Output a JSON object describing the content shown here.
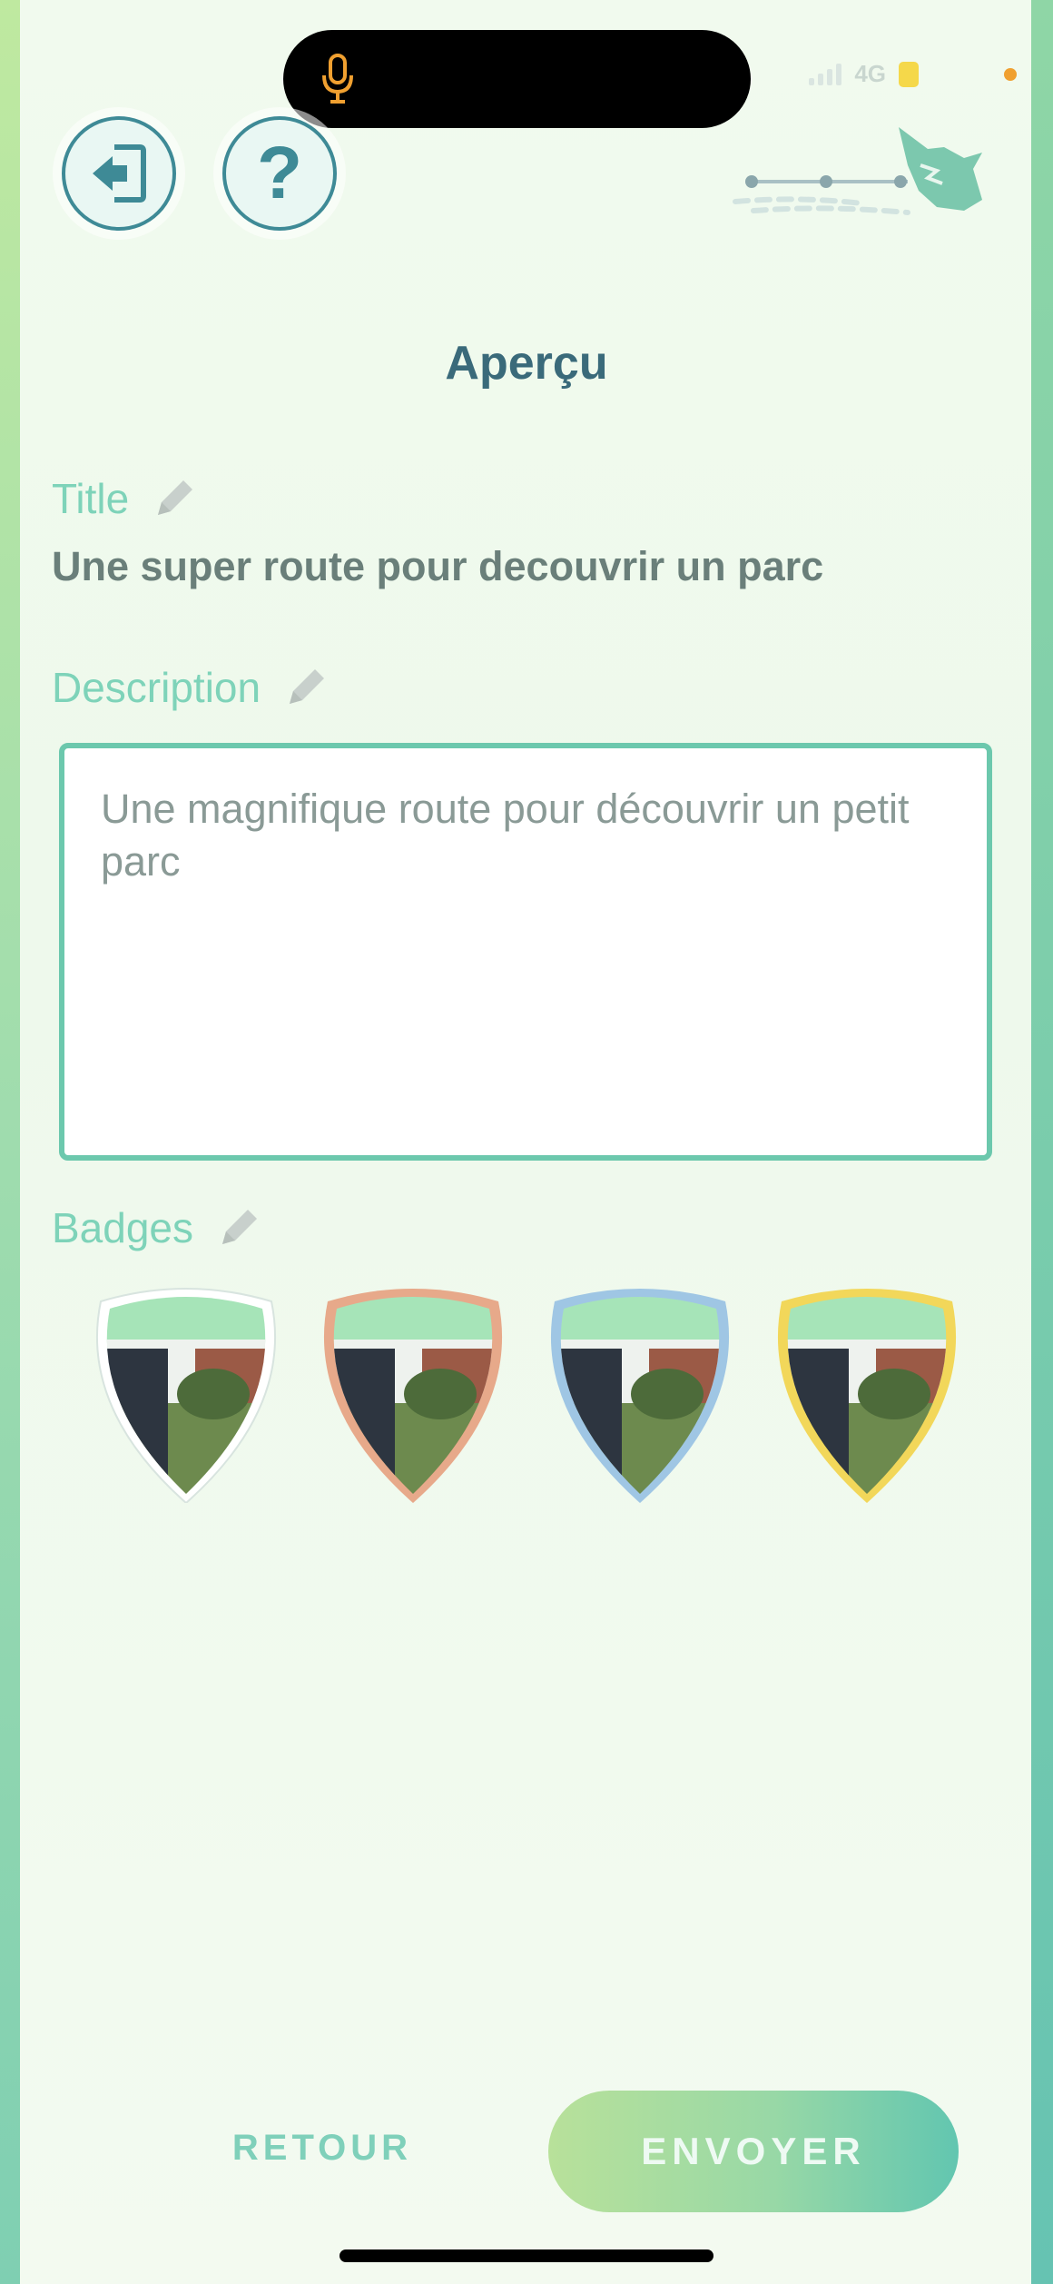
{
  "status_bar": {
    "network": "4G"
  },
  "header": {
    "title": "Aperçu",
    "exit_icon": "exit-door-arrow-icon",
    "help_label": "?"
  },
  "title_section": {
    "label": "Title",
    "value": "Une super route pour decouvrir un parc"
  },
  "description_section": {
    "label": "Description",
    "value": "Une magnifique route pour découvrir un petit parc"
  },
  "badges_section": {
    "label": "Badges",
    "badges": [
      {
        "tier": "white",
        "color": "#ffffff"
      },
      {
        "tier": "bronze",
        "color": "#e7a98a"
      },
      {
        "tier": "silver",
        "color": "#9fc6e4"
      },
      {
        "tier": "gold",
        "color": "#f2d75a"
      }
    ]
  },
  "footer": {
    "back_label": "RETOUR",
    "submit_label": "ENVOYER"
  },
  "colors": {
    "accent": "#6cc8ad",
    "title_text": "#3a6a7a",
    "button_icon": "#3e8a96"
  }
}
